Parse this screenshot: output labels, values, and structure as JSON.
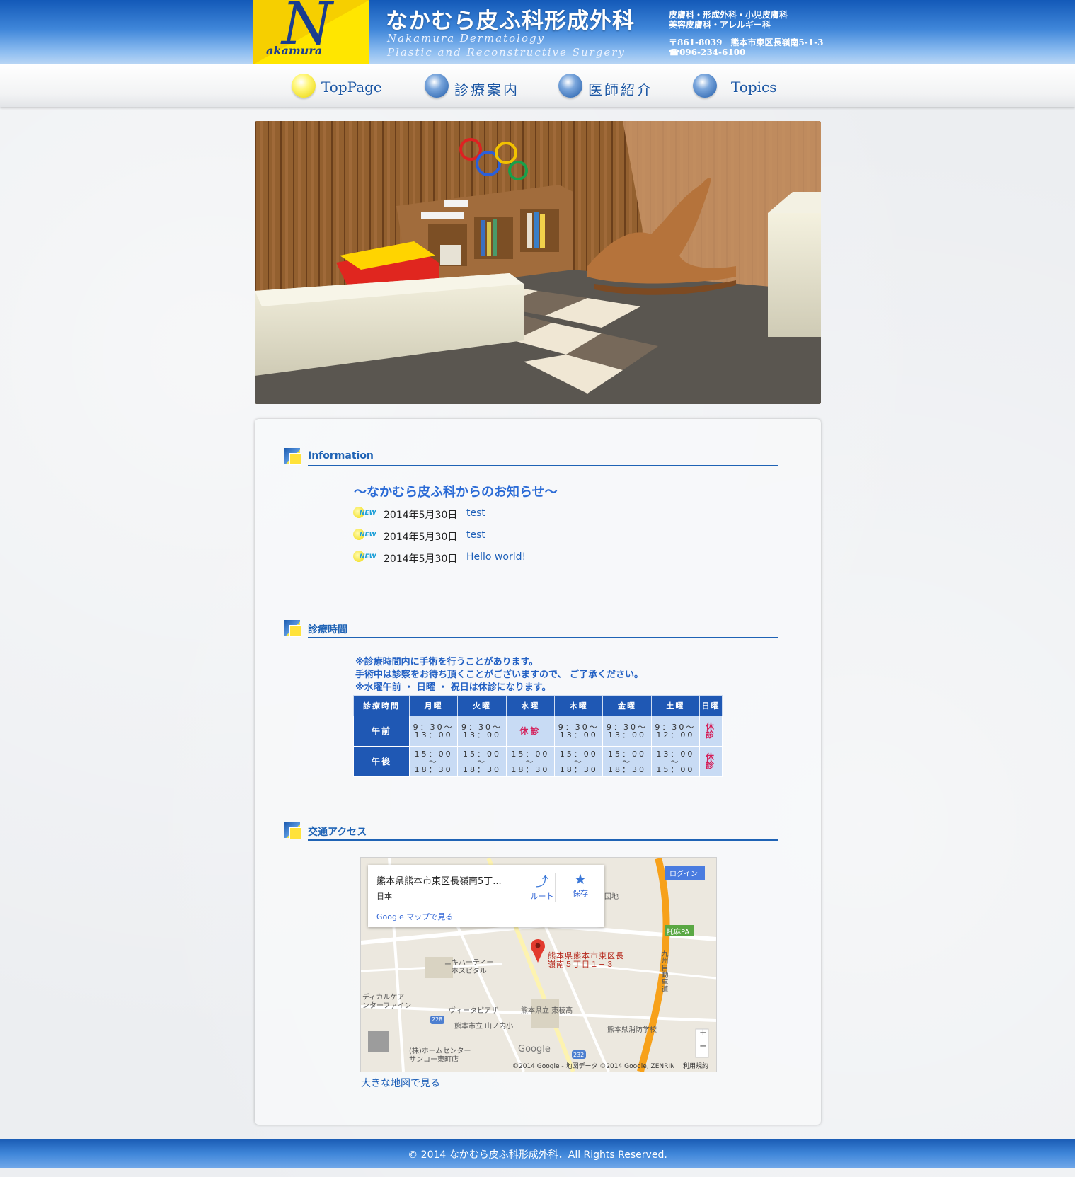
{
  "header": {
    "logo_letter": "N",
    "logo_word": "akamura",
    "site_title": "なかむら皮ふ科形成外科",
    "subtitle_line1": "Nakamura Dermatology",
    "subtitle_line2": "Plastic and Reconstructive Surgery",
    "departments_line1": "皮膚科・形成外科・小児皮膚科",
    "departments_line2": "美容皮膚科・アレルギー科",
    "postal_address": "〒861-8039　熊本市東区長嶺南5-1-3",
    "phone": "☎096-234-6100"
  },
  "nav": {
    "items": [
      {
        "label": "TopPage",
        "active": true
      },
      {
        "label": "診療案内",
        "active": false
      },
      {
        "label": "医師紹介",
        "active": false
      },
      {
        "label": "Topics",
        "active": false
      }
    ]
  },
  "information": {
    "heading": "Information",
    "title": "～なかむら皮ふ科からのお知らせ～",
    "news_badge": "NEW",
    "news": [
      {
        "date": "2014年5月30日",
        "title": "test"
      },
      {
        "date": "2014年5月30日",
        "title": "test"
      },
      {
        "date": "2014年5月30日",
        "title": "Hello world!"
      }
    ]
  },
  "hours": {
    "heading": "診療時間",
    "note1": "※診療時間内に手術を行うことがあります。",
    "note2": "手術中は診察をお待ち頂くことがございますので、 ご了承ください。",
    "note3": "※水曜午前 ・ 日曜 ・ 祝日は休診になります。",
    "header": [
      "診療時間",
      "月曜",
      "火曜",
      "水曜",
      "木曜",
      "金曜",
      "土曜",
      "日曜"
    ],
    "rows": [
      {
        "label": "午前",
        "cells": [
          "9：30～\n13：00",
          "9：30～\n13：00",
          "休診",
          "9：30～\n13：00",
          "9：30～\n13：00",
          "9：30～\n12：00",
          "休診"
        ]
      },
      {
        "label": "午後",
        "cells": [
          "15：00～\n18：30",
          "15：00～\n18：30",
          "15：00～\n18：30",
          "15：00～\n18：30",
          "15：00～\n18：30",
          "13：00～\n15：00",
          "休診"
        ]
      }
    ]
  },
  "access": {
    "heading": "交通アクセス",
    "map": {
      "card_title": "熊本県熊本市東区長嶺南5丁...",
      "card_country": "日本",
      "card_link": "Google マップで見る",
      "route_label": "ルート",
      "save_label": "保存",
      "login_label": "ログイン",
      "pin_label_line1": "熊本県熊本市東区長",
      "pin_label_line2": "嶺南５丁目１−３",
      "place1": "ニキハーティー",
      "place1b": "ホスピタル",
      "place2": "ヴィータピアザ",
      "place3": "熊本県立 東稜高",
      "place4": "熊本市立 山ノ内小",
      "place5": "熊本県消防学校",
      "place6": "(株)ホームセンター",
      "place6b": "サンコー東町店",
      "place7": "団地",
      "place8": "託麻PA",
      "place9": "ディカルケア",
      "place9b": "ンターファイン",
      "place10": "九州自動車道",
      "route_no1": "228",
      "route_no2": "232",
      "google": "Google",
      "attribution": "©2014 Google - 地図データ ©2014 Google, ZENRIN",
      "terms": "利用規約",
      "zoom_in": "+",
      "zoom_out": "−"
    },
    "big_map_link": "大きな地図で見る"
  },
  "footer": {
    "copyright": "© 2014 なかむら皮ふ科形成外科．All Rights Reserved."
  },
  "colors": {
    "primary": "#1f58b4",
    "accent": "#ffe600",
    "closed": "#d4205a"
  }
}
